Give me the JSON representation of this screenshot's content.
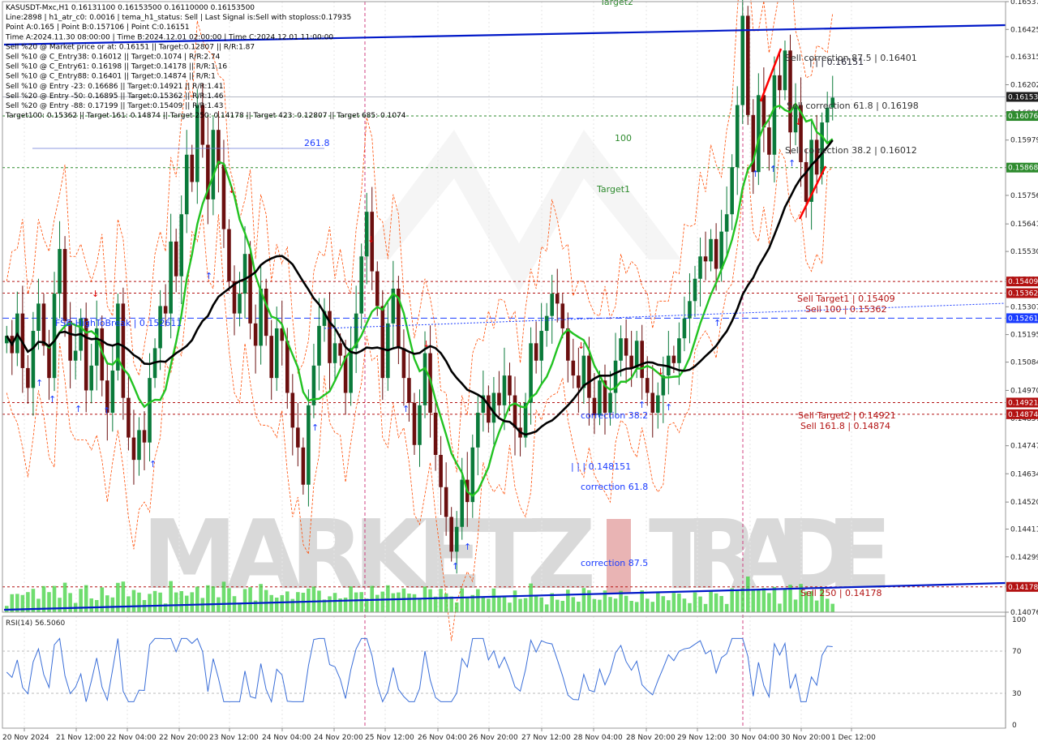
{
  "header": {
    "lines": [
      "KASUSDT-Mxc,H1  0.16131100 0.16153500 0.16110000 0.16153500",
      "Line:2898 | h1_atr_c0: 0.0016 | tema_h1_status: Sell | Last Signal is:Sell with stoploss:0.17935",
      "Point A:0.165 | Point B:0.157106 | Point C:0.16151",
      "Time A:2024.11.30 08:00:00 | Time B:2024.12.01 02:00:00 | Time C:2024.12.01 11:00:00",
      "Sell %20 @ Market price or at: 0.16151 || Target:0.12807 || R/R:1.87",
      "Sell %10 @ C_Entry38: 0.16012 || Target:0.1074 | R/R:2.74",
      "Sell %10 @ C_Entry61: 0.16198 || Target:0.14178 || R/R:1.16",
      "Sell %10 @ C_Entry88: 0.16401 || Target:0.14874 || R/R:1",
      "Sell %10 @ Entry -23: 0.16686 || Target:0.14921 || R/R:1.41",
      "Sell %20 @ Entry -50: 0.16895 || Target:0.15362 || R/R:1.46",
      "Sell %20 @ Entry -88: 0.17199 || Target:0.15409 || R/R:1.43",
      "Target100: 0.15362 || Target 161: 0.14874 || Target 250: 0.14178 || Target 423: 0.12807 || Target 685: 0.1074"
    ]
  },
  "rsi": {
    "label": "RSI(14) 56.5060",
    "levels": [
      100,
      70,
      30,
      0
    ]
  },
  "colors": {
    "bull": "#0a7a3a",
    "bear": "#6b0f0f",
    "ma_green": "#22c322",
    "ma_black": "#000000",
    "trend_blue": "#0018c8",
    "channel": "#ff4a00",
    "level_red": "#b31212",
    "level_green": "#2e8b2e",
    "current": "#1f1f1f",
    "watermark": "#d9d9d9",
    "watermark_red": "#e9b4b4"
  },
  "chart_data": {
    "type": "candlestick",
    "symbol": "KASUSDT-Mxc",
    "timeframe": "H1",
    "ylim": [
      0.14076,
      0.16537
    ],
    "y_ticks": [
      0.16537,
      0.16425,
      0.16315,
      0.16202,
      0.1609,
      0.15979,
      0.15868,
      0.15756,
      0.15641,
      0.1553,
      0.15418,
      0.15307,
      0.15195,
      0.15084,
      0.1497,
      0.14857,
      0.14747,
      0.14634,
      0.1452,
      0.14411,
      0.14299,
      0.14185,
      0.14076
    ],
    "x_ticks": [
      "20 Nov 2024",
      "21 Nov 12:00",
      "22 Nov 04:00",
      "22 Nov 20:00",
      "23 Nov 12:00",
      "24 Nov 04:00",
      "24 Nov 20:00",
      "25 Nov 12:00",
      "26 Nov 04:00",
      "26 Nov 20:00",
      "27 Nov 12:00",
      "28 Nov 04:00",
      "28 Nov 20:00",
      "29 Nov 12:00",
      "30 Nov 04:00",
      "30 Nov 20:00",
      "1 Dec 12:00"
    ],
    "price_tags": [
      {
        "value": "0.16153",
        "color": "#1f1f1f"
      },
      {
        "value": "0.16076",
        "color": "#2e8b2e"
      },
      {
        "value": "0.15868",
        "color": "#2e8b2e"
      },
      {
        "value": "0.15409",
        "color": "#b31212"
      },
      {
        "value": "0.15362",
        "color": "#b31212"
      },
      {
        "value": "0.15261",
        "color": "#1a3cff"
      },
      {
        "value": "0.14921",
        "color": "#b31212"
      },
      {
        "value": "0.14874",
        "color": "#b31212"
      },
      {
        "value": "0.14178",
        "color": "#b31212"
      }
    ],
    "levels": [
      {
        "price": 0.15409,
        "label": "Sell Target1 | 0.15409",
        "color": "#b31212"
      },
      {
        "price": 0.15362,
        "label": "Sell 100 | 0.15362",
        "color": "#b31212"
      },
      {
        "price": 0.14921,
        "label": "Sell Target2 | 0.14921",
        "color": "#b31212"
      },
      {
        "price": 0.14874,
        "label": "Sell 161.8 | 0.14874",
        "color": "#b31212"
      },
      {
        "price": 0.14178,
        "label": "Sell 250 | 0.14178",
        "color": "#b31212"
      },
      {
        "price": 0.16076,
        "label": "100",
        "color": "#2e8b2e"
      },
      {
        "price": 0.15868,
        "label": "Target1",
        "color": "#2e8b2e"
      },
      {
        "price": 0.16537,
        "label": "Target2",
        "color": "#2e8b2e"
      },
      {
        "price": 0.15261,
        "label": "FSB-HighToBreak | 0.152611",
        "color": "#1a3cff"
      }
    ],
    "annotations": [
      {
        "text": "Sell correction 87.5 | 0.16401",
        "price": 0.16401
      },
      {
        "text": "Sell correction 61.8 | 0.16198",
        "price": 0.16198
      },
      {
        "text": "Sell correction 38.2 | 0.16012",
        "price": 0.16012
      },
      {
        "text": "| | | 0.16151",
        "price": 0.16351
      },
      {
        "text": "correction 38.2",
        "price": 0.1488
      },
      {
        "text": "| | | 0.148151",
        "price": 0.147
      },
      {
        "text": "correction 61.8",
        "price": 0.1458
      },
      {
        "text": "correction 87.5",
        "price": 0.1424
      },
      {
        "text": "261.8",
        "price": 0.1599
      }
    ],
    "series": [
      {
        "name": "KASUSDT-Mxc,H1",
        "close": [
          0.1519,
          0.1512,
          0.1528,
          0.1506,
          0.1498,
          0.1521,
          0.1532,
          0.1515,
          0.1502,
          0.1536,
          0.1554,
          0.1525,
          0.1509,
          0.1513,
          0.1526,
          0.1497,
          0.1507,
          0.1522,
          0.1501,
          0.1488,
          0.1505,
          0.1532,
          0.1494,
          0.1478,
          0.1469,
          0.1481,
          0.1476,
          0.1502,
          0.1514,
          0.1531,
          0.1528,
          0.1557,
          0.1543,
          0.1568,
          0.1592,
          0.1581,
          0.1612,
          0.1596,
          0.1574,
          0.1602,
          0.1588,
          0.1562,
          0.1541,
          0.1528,
          0.1536,
          0.1552,
          0.1524,
          0.1515,
          0.1538,
          0.1519,
          0.1502,
          0.1522,
          0.1517,
          0.1496,
          0.1482,
          0.1474,
          0.1459,
          0.1491,
          0.1507,
          0.1523,
          0.1529,
          0.1508,
          0.1516,
          0.1511,
          0.1496,
          0.1514,
          0.1528,
          0.1551,
          0.1569,
          0.1545,
          0.1531,
          0.1502,
          0.1524,
          0.1538,
          0.1514,
          0.1502,
          0.1492,
          0.1475,
          0.1491,
          0.1512,
          0.1488,
          0.1471,
          0.1458,
          0.1446,
          0.1432,
          0.1442,
          0.1461,
          0.1452,
          0.1474,
          0.1488,
          0.1495,
          0.1484,
          0.1496,
          0.1491,
          0.1503,
          0.1495,
          0.1482,
          0.1478,
          0.1492,
          0.1516,
          0.1509,
          0.1521,
          0.1527,
          0.1536,
          0.1532,
          0.1522,
          0.1509,
          0.1503,
          0.1498,
          0.1511,
          0.1494,
          0.1487,
          0.1501,
          0.1488,
          0.1496,
          0.1509,
          0.1518,
          0.1511,
          0.1506,
          0.1517,
          0.1502,
          0.1496,
          0.1488,
          0.1495,
          0.1503,
          0.1511,
          0.1508,
          0.1518,
          0.1526,
          0.1533,
          0.1542,
          0.1551,
          0.1549,
          0.1558,
          0.1546,
          0.1561,
          0.1568,
          0.1587,
          0.1612,
          0.1648,
          0.1608,
          0.1585,
          0.1616,
          0.1603,
          0.1592,
          0.1624,
          0.1618,
          0.1634,
          0.1601,
          0.1612,
          0.1589,
          0.1573,
          0.1598,
          0.1584,
          0.1605,
          0.1611,
          0.1615
        ]
      },
      {
        "name": "MA green"
      },
      {
        "name": "MA black"
      }
    ]
  }
}
